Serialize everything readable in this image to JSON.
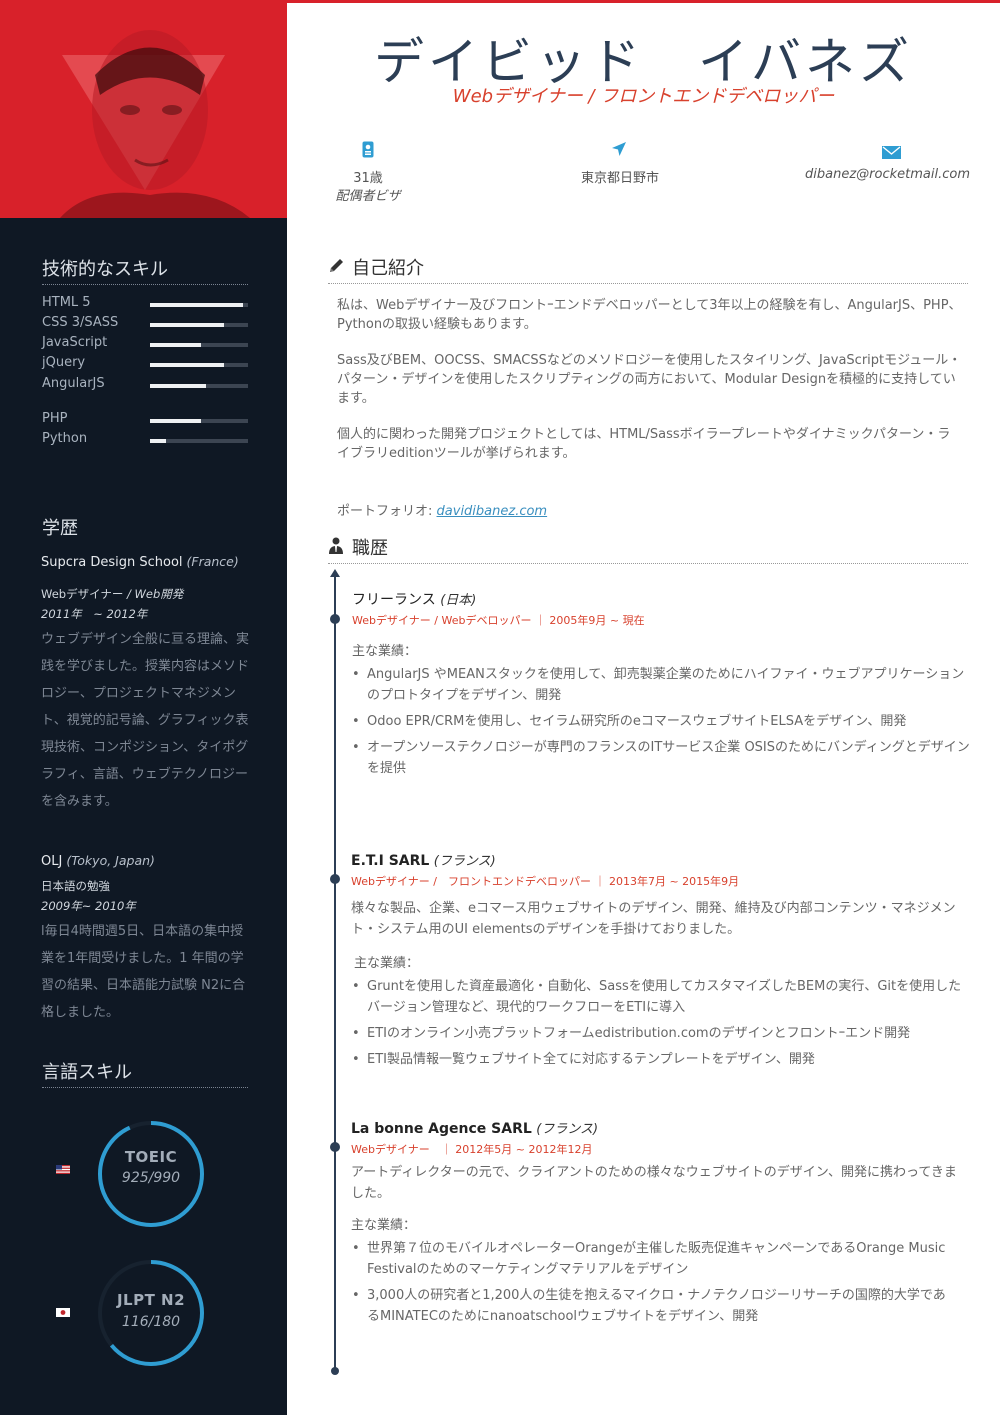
{
  "colors": {
    "accent": "#d8212a",
    "sidebar": "#0f1824",
    "navy": "#2c3e55",
    "ring": "#2f9dd2"
  },
  "header": {
    "name": "デイビッド　イバネズ",
    "role": "Webデザイナー / フロントエンドデベロッパー",
    "age": "31歳",
    "visa": "配偶者ビザ",
    "location": "東京都日野市",
    "email": "dibanez@rocketmail.com"
  },
  "sidebar": {
    "skills_title": "技術的なスキル",
    "skills": [
      {
        "name": "HTML 5",
        "level": 0.95
      },
      {
        "name": "CSS 3/SASS",
        "level": 0.76
      },
      {
        "name": "JavaScript",
        "level": 0.52
      },
      {
        "name": "jQuery",
        "level": 0.76
      },
      {
        "name": "AngularJS",
        "level": 0.57
      },
      {
        "name": "PHP",
        "level": 0.52
      },
      {
        "name": "Python",
        "level": 0.16
      }
    ],
    "education_title": "学歴",
    "education": [
      {
        "school": "Supcra Design School",
        "location": "(France)",
        "course": "Webデザイナー",
        "course_sub": "/ Web開発",
        "period": "2011年　~ 2012年",
        "desc": "ウェブデザイン全般に亘る理論、実践を学びました。授業内容はメソドロジー、プロジェクトマネジメント、視覚的記号論、グラフィック表現技術、コンポジション、タイポグラフィ、言語、ウェブテクノロジーを含みます。"
      },
      {
        "school": "OLJ",
        "location": "(Tokyo, Japan)",
        "course": "日本語の勉強",
        "course_sub": "",
        "period": "2009年~ 2010年",
        "desc": "l毎日4時間週5日、日本語の集中授業を1年間受けました。1 年間の学習の結果、日本語能力試験 N2に合格しました。"
      }
    ],
    "languages_title": "言語スキル",
    "languages": [
      {
        "name": "TOEIC",
        "score": "925/990",
        "ratio": 0.93,
        "flag": "us-flag-icon"
      },
      {
        "name": "JLPT N2",
        "score": "116/180",
        "ratio": 0.64,
        "flag": "jp-flag-icon"
      }
    ]
  },
  "about": {
    "title": "自己紹介",
    "p1": "私は、Webデザイナー及びフロントｰエンドデベロッパーとして3年以上の経験を有し、AngularJS、PHP、Pythonの取扱い経験もあります。",
    "p2": "Sass及びBEM、OOCSS、SMACSSなどのメソドロジーを使用したスタイリング、JavaScriptモジュール・パターン・デザインを使用したスクリプティングの両方において、Modular Designを積極的に支持しています。",
    "p3": "個人的に関わった開発プロジェクトとしては、HTML/Sassボイラープレートやダイナミックパターン・ライブラリeditionツールが挙げられます。",
    "portfolio_label": "ポートフォリオ:",
    "portfolio_link": "davidibanez.com"
  },
  "work": {
    "title": "職歴",
    "jobs": [
      {
        "company": "フリーランス",
        "location": "(日本)",
        "subtitle": "Webデザイナー / Webデベロッパー ｜ 2005年9月 ~ 現在",
        "text": "",
        "label": "主な業績：",
        "bullets": [
          "AngularJS やMEANスタックを使用して、卸売製薬企業のためにハイファイ・ウェブアプリケーションのプロトタイプをデザイン、開発",
          "Odoo EPR/CRMを使用し、セイラム研究所のeコマースウェブサイトELSAをデザイン、開発",
          "オープンソーステクノロジーが専門のフランスのITサービス企業 OSISのためにバンディングとデザインを提供"
        ]
      },
      {
        "company": "E.T.I SARL",
        "location": "(フランス)",
        "subtitle": "Webデザイナー /　フロントエンドデベロッパー ｜ 2013年7月 ~ 2015年9月",
        "text": "様々な製品、企業、eコマース用ウェブサイトのデザイン、開発、維持及び内部コンテンツ・マネジメント・システム用のUI elementsのデザインを手掛けておりました。",
        "label": "主な業績：",
        "bullets": [
          "Gruntを使用した資産最適化・自動化、Sassを使用してカスタマイズしたBEMの実行、Gitを使用したバージョン管理など、現代的ワークフローをETIに導入",
          "ETIのオンライン小売プラットフォームedistribution.comのデザインとフロントｰエンド開発",
          "ETI製品情報一覧ウェブサイト全てに対応するテンプレートをデザイン、開発"
        ]
      },
      {
        "company": "La bonne Agence SARL",
        "location": "(フランス)",
        "subtitle": "Webデザイナー　｜ 2012年5月 ~ 2012年12月",
        "text": "アートディレクターの元で、クライアントのための様々なウェブサイトのデザイン、開発に携わってきました。",
        "label": "主な業績：",
        "bullets": [
          "世界第７位のモバイルオペレーターOrangeが主催した販売促進キャンペーンであるOrange Music Festivalのためのマーケティングマテリアルをデザイン",
          "3,000人の研究者と1,200人の生徒を抱えるマイクロ・ナノテクノロジーリサーチの国際的大学であるMINATECのためにnanoatschoolウェブサイトをデザイン、開発"
        ]
      }
    ]
  }
}
